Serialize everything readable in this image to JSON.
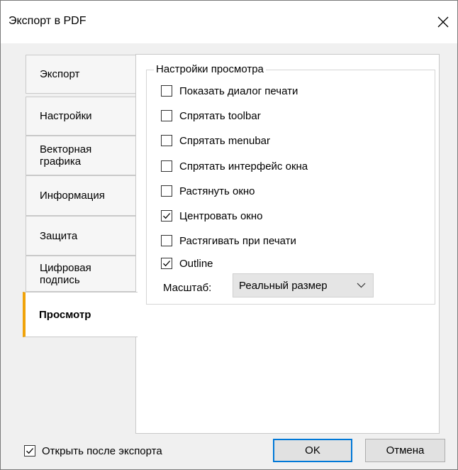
{
  "window": {
    "title": "Экспорт в PDF"
  },
  "tabs": [
    {
      "label": "Экспорт",
      "active": false
    },
    {
      "label": "Настройки",
      "active": false
    },
    {
      "label": "Векторная графика",
      "active": false
    },
    {
      "label": "Информация",
      "active": false
    },
    {
      "label": "Защита",
      "active": false
    },
    {
      "label": "Цифровая подпись",
      "active": false
    },
    {
      "label": "Просмотр",
      "active": true
    }
  ],
  "viewer_settings": {
    "group_title": "Настройки просмотра",
    "options": [
      {
        "label": "Показать диалог печати",
        "checked": false
      },
      {
        "label": "Спрятать toolbar",
        "checked": false
      },
      {
        "label": "Спрятать menubar",
        "checked": false
      },
      {
        "label": "Спрятать интерфейс окна",
        "checked": false
      },
      {
        "label": "Растянуть окно",
        "checked": false
      },
      {
        "label": "Центровать окно",
        "checked": true
      },
      {
        "label": "Растягивать при печати",
        "checked": false
      },
      {
        "label": "Outline",
        "checked": true
      }
    ],
    "scale_label": "Масштаб:",
    "scale_value": "Реальный размер"
  },
  "footer": {
    "open_after_export_label": "Открыть после экспорта",
    "open_after_export_checked": true,
    "ok_label": "OK",
    "cancel_label": "Отмена"
  },
  "colors": {
    "active_tab_accent": "#f0a30a",
    "default_button_border": "#0078d7"
  }
}
